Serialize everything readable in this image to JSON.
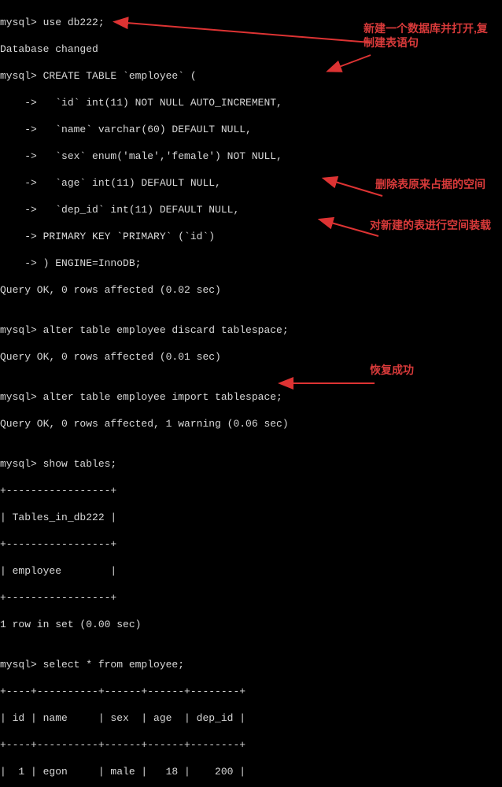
{
  "terminal": {
    "l1": "mysql> use db222;",
    "l2": "Database changed",
    "l3": "mysql> CREATE TABLE `employee` (",
    "l4": "    ->   `id` int(11) NOT NULL AUTO_INCREMENT,",
    "l5": "    ->   `name` varchar(60) DEFAULT NULL,",
    "l6": "    ->   `sex` enum('male','female') NOT NULL,",
    "l7": "    ->   `age` int(11) DEFAULT NULL,",
    "l8": "    ->   `dep_id` int(11) DEFAULT NULL,",
    "l9": "    -> PRIMARY KEY `PRIMARY` (`id`)",
    "l10": "    -> ) ENGINE=InnoDB;",
    "l11": "Query OK, 0 rows affected (0.02 sec)",
    "l12": "",
    "l13": "mysql> alter table employee discard tablespace;",
    "l14": "Query OK, 0 rows affected (0.01 sec)",
    "l15": "",
    "l16": "mysql> alter table employee import tablespace;",
    "l17": "Query OK, 0 rows affected, 1 warning (0.06 sec)",
    "l18": "",
    "l19": "mysql> show tables;",
    "l20": "+-----------------+",
    "l21": "| Tables_in_db222 |",
    "l22": "+-----------------+",
    "l23": "| employee        |",
    "l24": "+-----------------+",
    "l25": "1 row in set (0.00 sec)",
    "l26": "",
    "l27": "mysql> select * from employee;",
    "l28": "+----+----------+------+------+--------+",
    "l29": "| id | name     | sex  | age  | dep_id |",
    "l30": "+----+----------+------+------+--------+",
    "l31": "|  1 | egon     | male |   18 |    200 |"
  },
  "annotations": {
    "a1": "新建一个数据库并打开,复制建表语句",
    "a2": "删除表原来占据的空间",
    "a3": "对新建的表进行空间装载",
    "a4": "恢复成功"
  },
  "chart_data": {
    "type": "table",
    "title": "employee",
    "columns": [
      "id",
      "name",
      "sex",
      "age",
      "dep_id"
    ],
    "rows": [
      [
        1,
        "egon",
        "male",
        18,
        200
      ]
    ]
  }
}
